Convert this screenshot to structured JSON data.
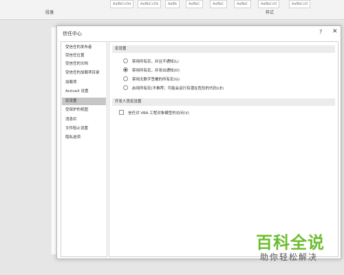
{
  "ribbon": {
    "paragraph_group_label": "段落",
    "styles_group_label": "样式",
    "style_gallery": [
      "AaBbCcDd",
      "AaBbCcDd",
      "AaBb",
      "AaBbC",
      "AaBbC",
      "AaBbC",
      "AaBbCcD",
      "AaBbCcD"
    ]
  },
  "dialog": {
    "title": "信任中心",
    "help_label": "?",
    "close_label": "✕"
  },
  "sidebar": {
    "items": [
      {
        "label": "受信任的发布者",
        "selected": false
      },
      {
        "label": "受信任位置",
        "selected": false
      },
      {
        "label": "受信任的文档",
        "selected": false
      },
      {
        "label": "受信任的加载项目录",
        "selected": false
      },
      {
        "label": "加载项",
        "selected": false
      },
      {
        "label": "ActiveX 设置",
        "selected": false
      },
      {
        "label": "宏设置",
        "selected": true
      },
      {
        "label": "受保护的视图",
        "selected": false
      },
      {
        "label": "消息栏",
        "selected": false
      },
      {
        "label": "文件阻止设置",
        "selected": false
      },
      {
        "label": "隐私选项",
        "selected": false
      }
    ]
  },
  "macro_settings": {
    "header": "宏设置",
    "options": [
      {
        "label": "禁用所有宏，并且不通知(L)",
        "selected": false
      },
      {
        "label": "禁用所有宏，并发出通知(D)",
        "selected": true
      },
      {
        "label": "禁用无数字签署的所有宏(G)",
        "selected": false
      },
      {
        "label": "启用所有宏(不推荐；可能会运行有潜在危险的代码)(E)",
        "selected": false
      }
    ]
  },
  "developer_settings": {
    "header": "开发人员宏设置",
    "trust_vba_label": "信任对 VBA 工程对象模型的访问(V)",
    "trust_vba_checked": false
  },
  "watermark": {
    "main": "百科全说",
    "sub": "助你轻松解决"
  },
  "colors": {
    "watermark_green": "#6bbd2e",
    "selected_item_bg": "#c6c6c6"
  }
}
